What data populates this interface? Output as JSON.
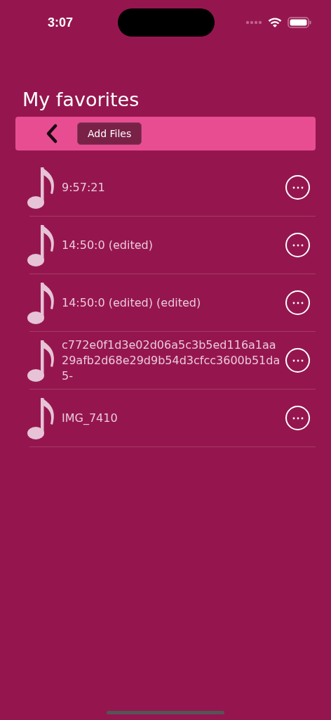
{
  "status_bar": {
    "time": "3:07"
  },
  "title": "My favorites",
  "toolbar": {
    "add_button": "Add Files"
  },
  "files": [
    {
      "name": "9:57:21"
    },
    {
      "name": "14:50:0 (edited)"
    },
    {
      "name": "14:50:0 (edited) (edited)"
    },
    {
      "name": "c772e0f1d3e02d06a5c3b5ed116a1aa29afb2d68e29d9b54d3cfcc3600b51da5-"
    },
    {
      "name": "IMG_7410"
    }
  ]
}
